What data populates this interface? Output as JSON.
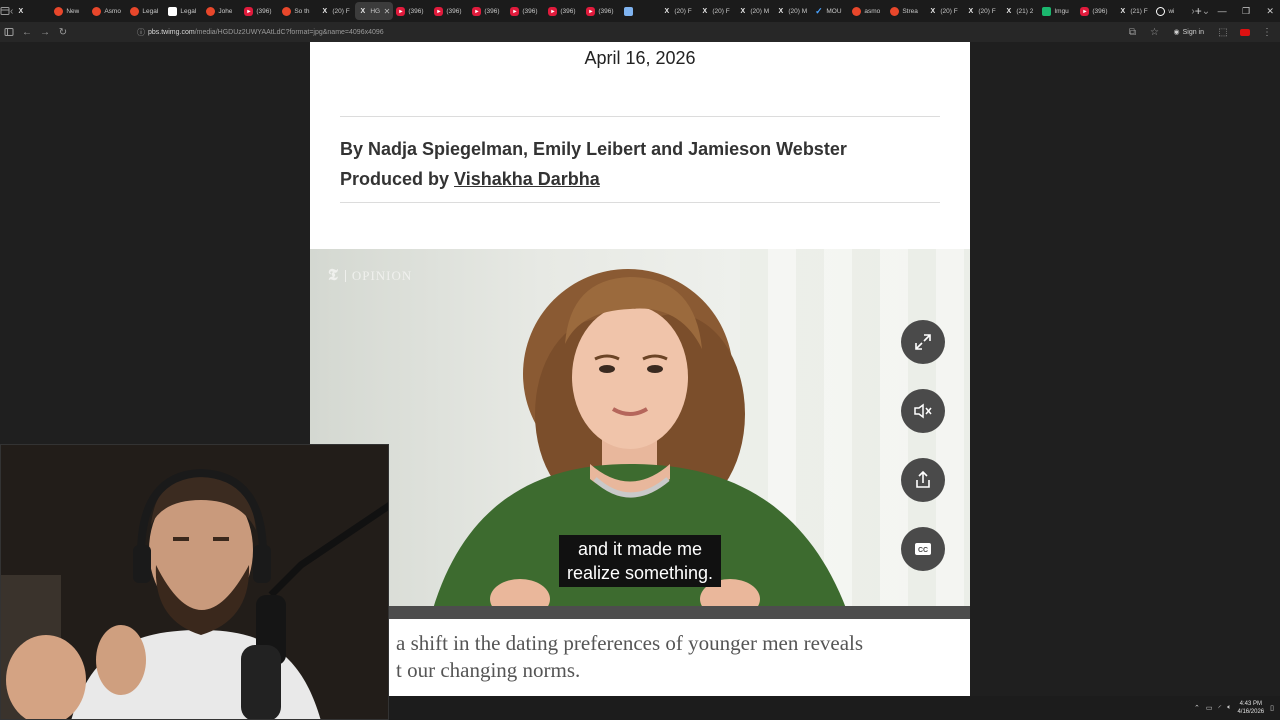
{
  "browser": {
    "tabs": [
      {
        "label": "",
        "color": "#e8472b",
        "icon": "x-icon"
      },
      {
        "label": "New",
        "color": "#e8472b",
        "icon": "reddit-icon"
      },
      {
        "label": "Asmo",
        "color": "#e8472b",
        "icon": "reddit-icon"
      },
      {
        "label": "Legal",
        "color": "#e8472b",
        "icon": "reddit-icon"
      },
      {
        "label": "Legal",
        "color": "#ffffff",
        "icon": "page-icon"
      },
      {
        "label": "Johe",
        "color": "#e8472b",
        "icon": "reddit-icon"
      },
      {
        "label": "(396)",
        "color": "#e01b3c",
        "icon": "youtube-icon"
      },
      {
        "label": "So th",
        "color": "#e8472b",
        "icon": "reddit-icon"
      },
      {
        "label": "(20) F",
        "color": "#000000",
        "icon": "x-icon"
      },
      {
        "label": "HG",
        "color": "#000000",
        "icon": "x-icon",
        "active": true
      },
      {
        "label": "(396)",
        "color": "#e01b3c",
        "icon": "youtube-icon"
      },
      {
        "label": "(396)",
        "color": "#e01b3c",
        "icon": "youtube-icon"
      },
      {
        "label": "(396)",
        "color": "#e01b3c",
        "icon": "youtube-icon"
      },
      {
        "label": "(396)",
        "color": "#e01b3c",
        "icon": "youtube-icon"
      },
      {
        "label": "(396)",
        "color": "#e01b3c",
        "icon": "youtube-icon"
      },
      {
        "label": "(396)",
        "color": "#e01b3c",
        "icon": "youtube-icon"
      },
      {
        "label": "",
        "color": "#7fb3f0",
        "icon": "page-icon"
      },
      {
        "label": "(20) F",
        "color": "#000000",
        "icon": "x-icon"
      },
      {
        "label": "(20) F",
        "color": "#000000",
        "icon": "x-icon"
      },
      {
        "label": "(20) M",
        "color": "#000000",
        "icon": "x-icon"
      },
      {
        "label": "(20) M",
        "color": "#000000",
        "icon": "x-icon"
      },
      {
        "label": "MOU",
        "color": "#4aa3ff",
        "icon": "check-icon"
      },
      {
        "label": "asmo",
        "color": "#e8472b",
        "icon": "reddit-icon"
      },
      {
        "label": "Strea",
        "color": "#e8472b",
        "icon": "reddit-icon"
      },
      {
        "label": "(20) F",
        "color": "#000000",
        "icon": "x-icon"
      },
      {
        "label": "(20) F",
        "color": "#000000",
        "icon": "x-icon"
      },
      {
        "label": "(21) 2",
        "color": "#000000",
        "icon": "x-icon"
      },
      {
        "label": "Imgu",
        "color": "#1bb76e",
        "icon": "imgur-icon"
      },
      {
        "label": "(396)",
        "color": "#e01b3c",
        "icon": "youtube-icon"
      },
      {
        "label": "(21) F",
        "color": "#000000",
        "icon": "x-icon"
      },
      {
        "label": "wi",
        "color": "#ffffff",
        "icon": "globe-icon"
      }
    ],
    "url_host": "pbs.twimg.com",
    "url_path": "/media/HGDUz2UWYAAtLdC?format=jpg&name=4096x4096",
    "sign_in": "Sign in"
  },
  "article": {
    "date": "April 16, 2026",
    "byline_prefix": "By Nadja Spiegelman, Emily Leibert and Jamieson Webster",
    "produced_prefix": "Produced by ",
    "producer": "Vishakha Darbha",
    "video": {
      "brand": "OPINION",
      "caption_line1": "and it made me",
      "caption_line2": "realize something."
    },
    "summary_line1": "a shift in the dating preferences of younger men reveals",
    "summary_line2": "t our changing norms."
  },
  "taskbar": {
    "time": "4:43 PM",
    "date": "4/16/2026"
  }
}
